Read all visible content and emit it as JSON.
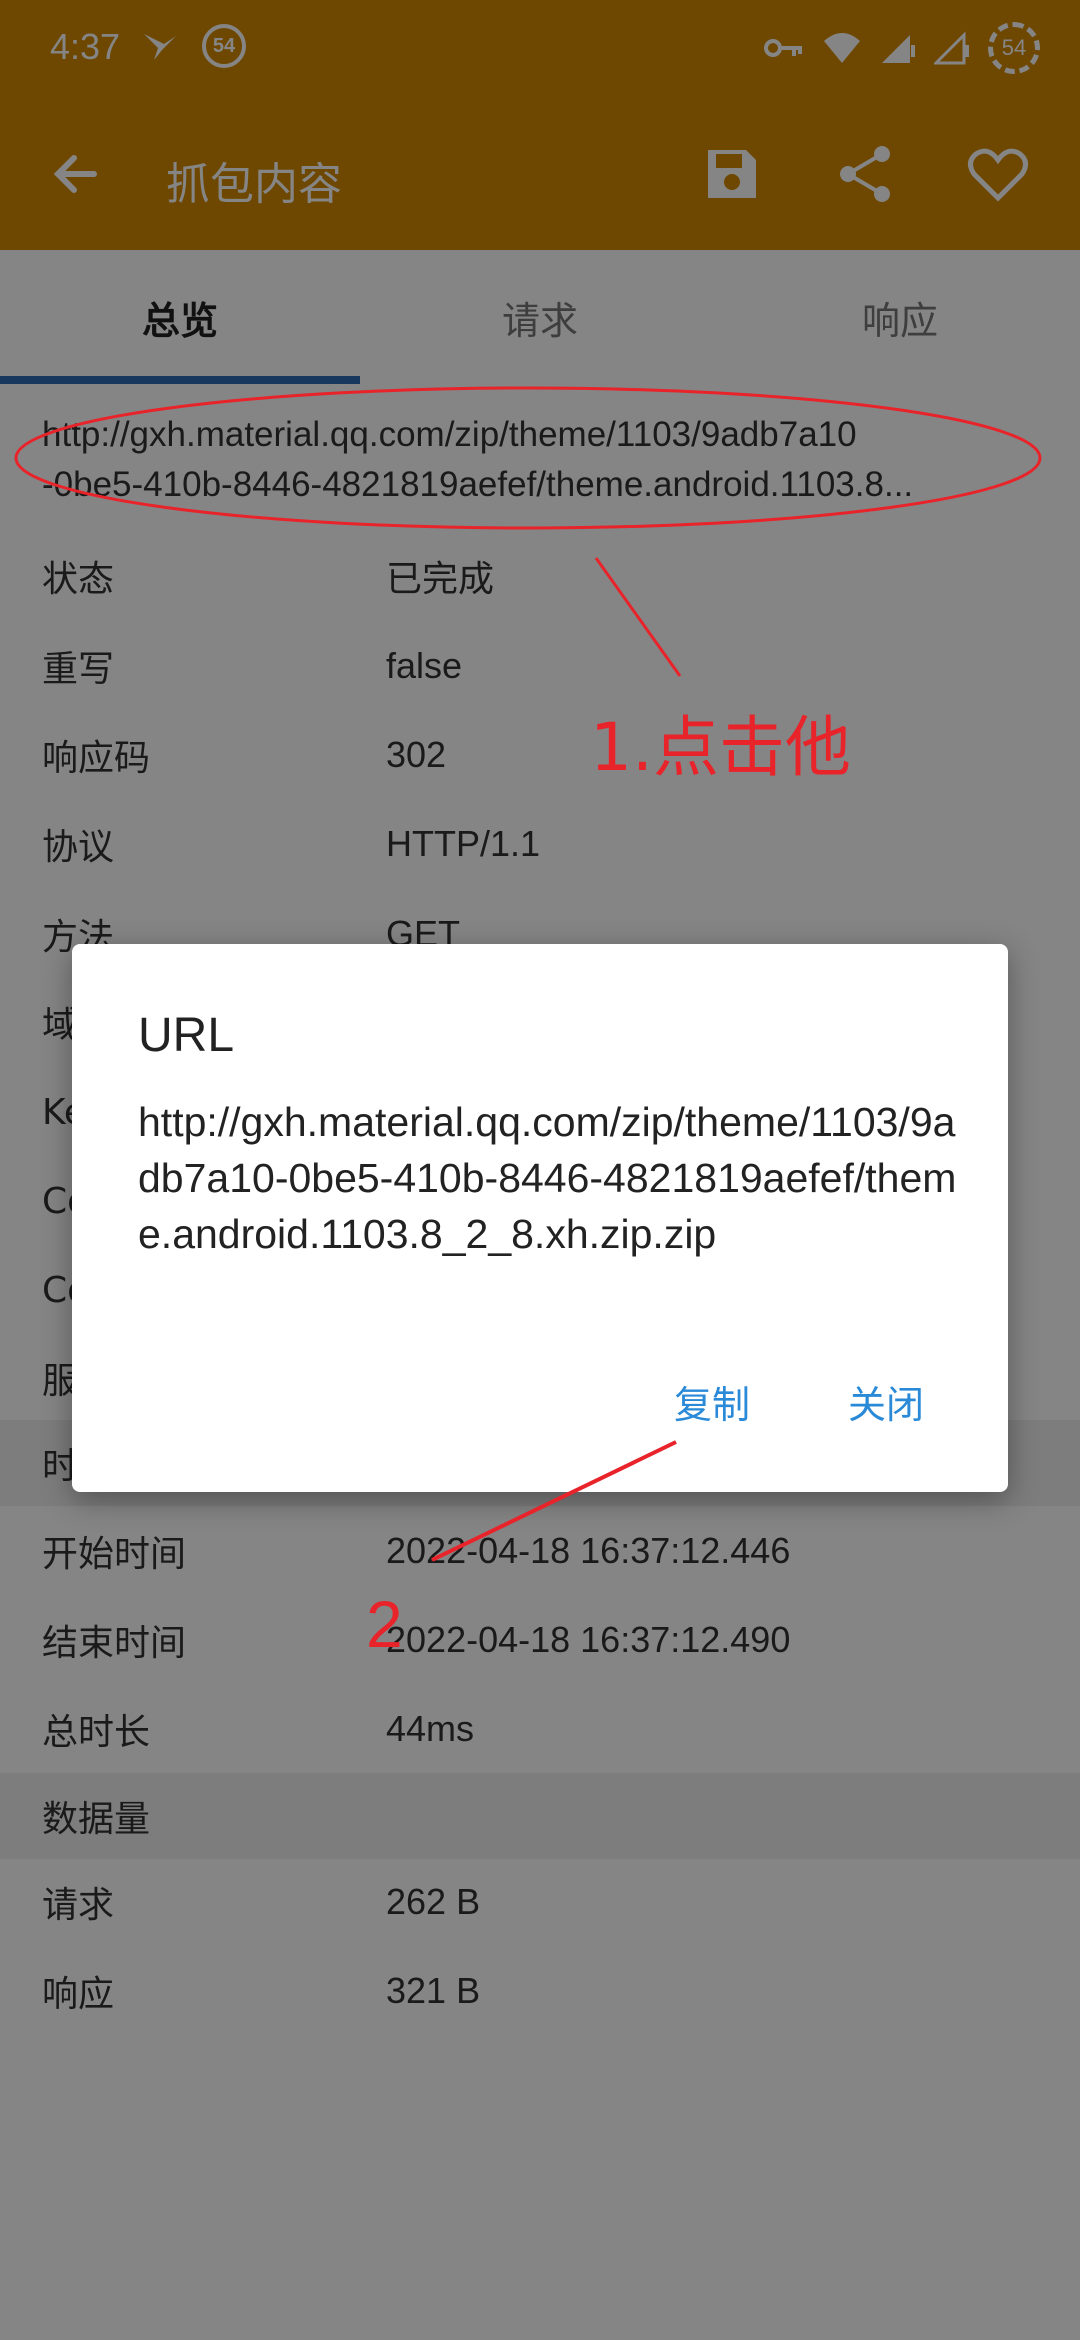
{
  "status_bar": {
    "time": "4:37",
    "left_badge": "54",
    "battery": "54",
    "icons": [
      "bird-icon",
      "badge-54-icon",
      "key-icon",
      "wifi-icon",
      "signal-icon",
      "signal-icon",
      "battery-icon"
    ]
  },
  "appbar": {
    "title": "抓包内容",
    "actions": [
      "save-icon",
      "share-icon",
      "heart-icon"
    ]
  },
  "tabs": [
    {
      "label": "总览",
      "active": true
    },
    {
      "label": "请求",
      "active": false
    },
    {
      "label": "响应",
      "active": false
    }
  ],
  "overview": {
    "url_line1": "http://gxh.material.qq.com/zip/theme/1103/9adb7a10",
    "url_line2": "-0be5-410b-8446-4821819aefef/theme.android.1103.8...",
    "rows_top": [
      {
        "label": "状态",
        "value": "已完成"
      },
      {
        "label": "重写",
        "value": "false"
      },
      {
        "label": "响应码",
        "value": "302"
      },
      {
        "label": "协议",
        "value": "HTTP/1.1"
      },
      {
        "label": "方法",
        "value": "GET"
      },
      {
        "label": "域",
        "value": ""
      },
      {
        "label": "Ke",
        "value": ""
      },
      {
        "label": "Co",
        "value": ""
      },
      {
        "label": "Co",
        "value": ""
      },
      {
        "label": "服",
        "value": ""
      }
    ],
    "time_section": "时",
    "rows_time": [
      {
        "label": "开始时间",
        "value": "2022-04-18 16:37:12.446"
      },
      {
        "label": "结束时间",
        "value": "2022-04-18 16:37:12.490"
      },
      {
        "label": "总时长",
        "value": "44ms"
      }
    ],
    "data_section": "数据量",
    "rows_data": [
      {
        "label": "请求",
        "value": "262 B"
      },
      {
        "label": "响应",
        "value": "321 B"
      }
    ]
  },
  "dialog": {
    "title": "URL",
    "body": "http://gxh.material.qq.com/zip/theme/1103/9adb7a10-0be5-410b-8446-4821819aefef/theme.android.1103.8_2_8.xh.zip.zip",
    "copy_label": "复制",
    "close_label": "关闭"
  },
  "annotations": {
    "step1": "1.点击他",
    "step2": "2"
  },
  "colors": {
    "appbar": "#d38a00",
    "tab_indicator": "#2f6db3",
    "dialog_button": "#2a8ad8",
    "annotation": "#e8232a"
  }
}
